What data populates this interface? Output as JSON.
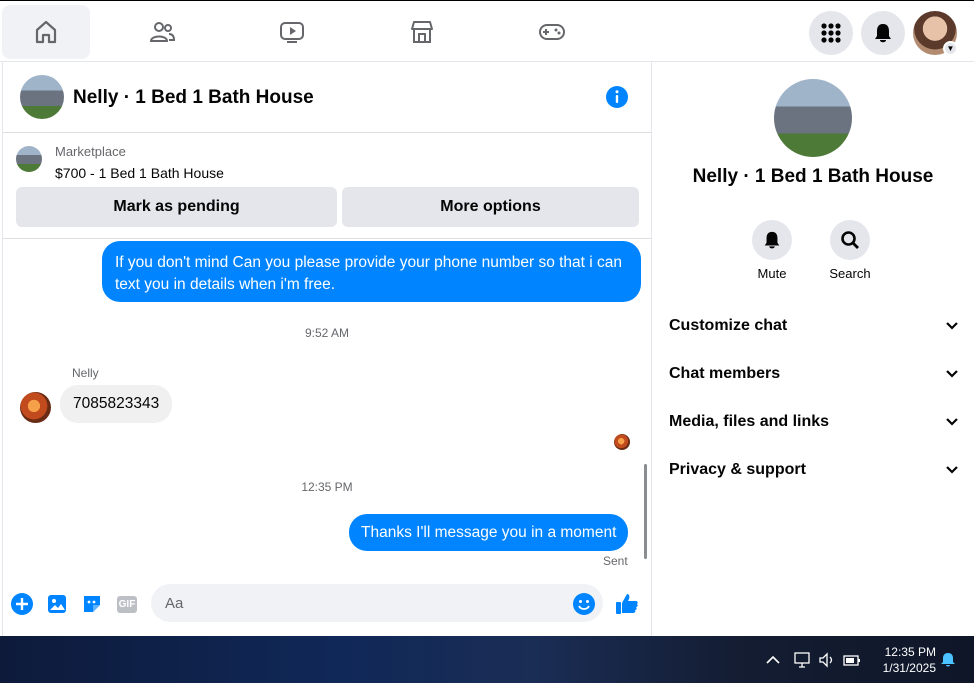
{
  "nav": {
    "tabs": [
      {
        "name": "home",
        "icon": "home-icon",
        "active": true
      },
      {
        "name": "friends",
        "icon": "friends-icon"
      },
      {
        "name": "video",
        "icon": "video-icon"
      },
      {
        "name": "marketplace",
        "icon": "marketplace-icon"
      },
      {
        "name": "gaming",
        "icon": "gaming-icon"
      }
    ],
    "right_icons": [
      "menu-grid-icon",
      "notifications-bell-icon",
      "profile-avatar"
    ]
  },
  "chat": {
    "title": "Nelly · 1 Bed 1 Bath House",
    "marketplace": {
      "label": "Marketplace",
      "listing": "$700 - 1 Bed 1 Bath House",
      "pending_button": "Mark as pending",
      "more_button": "More options"
    },
    "messages": [
      {
        "type": "out",
        "text": "If you don't mind Can you please provide your phone number so that i can text you in details when i'm free."
      },
      {
        "type": "time",
        "text": "9:52 AM"
      },
      {
        "type": "in",
        "sender": "Nelly",
        "text": "7085823343"
      },
      {
        "type": "time",
        "text": "12:35 PM"
      },
      {
        "type": "out",
        "text": "Thanks I'll message you in a moment",
        "status": "Sent"
      }
    ],
    "composer": {
      "placeholder": "Aa",
      "gif_label": "GIF"
    }
  },
  "details": {
    "title": "Nelly · 1 Bed 1 Bath House",
    "actions": [
      {
        "label": "Mute"
      },
      {
        "label": "Search"
      }
    ],
    "sections": [
      "Customize chat",
      "Chat members",
      "Media, files and links",
      "Privacy & support"
    ]
  },
  "taskbar": {
    "time": "12:35 PM",
    "date": "1/31/2025"
  },
  "colors": {
    "accent": "#0084ff",
    "button_bg": "#e4e6eb",
    "taskbar": "#102858"
  }
}
